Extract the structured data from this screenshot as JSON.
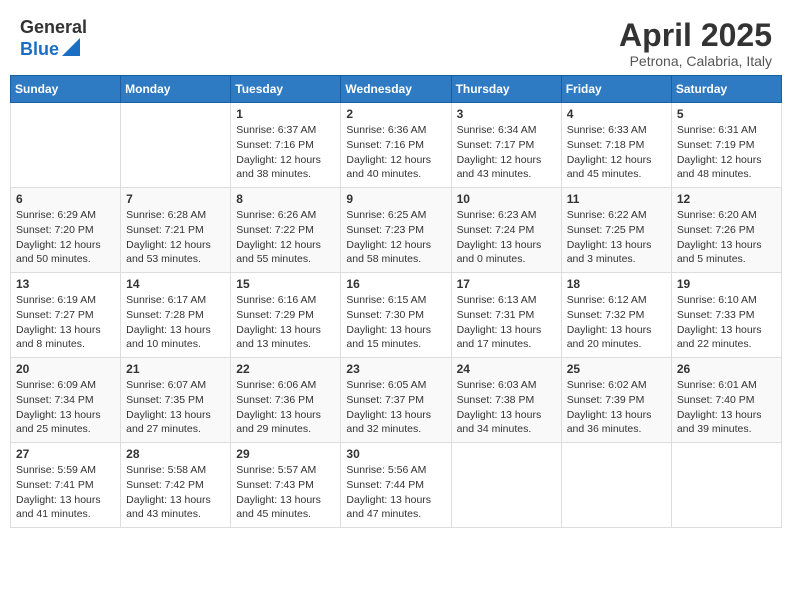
{
  "header": {
    "logo_general": "General",
    "logo_blue": "Blue",
    "month_year": "April 2025",
    "location": "Petrona, Calabria, Italy"
  },
  "days_of_week": [
    "Sunday",
    "Monday",
    "Tuesday",
    "Wednesday",
    "Thursday",
    "Friday",
    "Saturday"
  ],
  "weeks": [
    [
      {
        "day": "",
        "sunrise": "",
        "sunset": "",
        "daylight": ""
      },
      {
        "day": "",
        "sunrise": "",
        "sunset": "",
        "daylight": ""
      },
      {
        "day": "1",
        "sunrise": "Sunrise: 6:37 AM",
        "sunset": "Sunset: 7:16 PM",
        "daylight": "Daylight: 12 hours and 38 minutes."
      },
      {
        "day": "2",
        "sunrise": "Sunrise: 6:36 AM",
        "sunset": "Sunset: 7:16 PM",
        "daylight": "Daylight: 12 hours and 40 minutes."
      },
      {
        "day": "3",
        "sunrise": "Sunrise: 6:34 AM",
        "sunset": "Sunset: 7:17 PM",
        "daylight": "Daylight: 12 hours and 43 minutes."
      },
      {
        "day": "4",
        "sunrise": "Sunrise: 6:33 AM",
        "sunset": "Sunset: 7:18 PM",
        "daylight": "Daylight: 12 hours and 45 minutes."
      },
      {
        "day": "5",
        "sunrise": "Sunrise: 6:31 AM",
        "sunset": "Sunset: 7:19 PM",
        "daylight": "Daylight: 12 hours and 48 minutes."
      }
    ],
    [
      {
        "day": "6",
        "sunrise": "Sunrise: 6:29 AM",
        "sunset": "Sunset: 7:20 PM",
        "daylight": "Daylight: 12 hours and 50 minutes."
      },
      {
        "day": "7",
        "sunrise": "Sunrise: 6:28 AM",
        "sunset": "Sunset: 7:21 PM",
        "daylight": "Daylight: 12 hours and 53 minutes."
      },
      {
        "day": "8",
        "sunrise": "Sunrise: 6:26 AM",
        "sunset": "Sunset: 7:22 PM",
        "daylight": "Daylight: 12 hours and 55 minutes."
      },
      {
        "day": "9",
        "sunrise": "Sunrise: 6:25 AM",
        "sunset": "Sunset: 7:23 PM",
        "daylight": "Daylight: 12 hours and 58 minutes."
      },
      {
        "day": "10",
        "sunrise": "Sunrise: 6:23 AM",
        "sunset": "Sunset: 7:24 PM",
        "daylight": "Daylight: 13 hours and 0 minutes."
      },
      {
        "day": "11",
        "sunrise": "Sunrise: 6:22 AM",
        "sunset": "Sunset: 7:25 PM",
        "daylight": "Daylight: 13 hours and 3 minutes."
      },
      {
        "day": "12",
        "sunrise": "Sunrise: 6:20 AM",
        "sunset": "Sunset: 7:26 PM",
        "daylight": "Daylight: 13 hours and 5 minutes."
      }
    ],
    [
      {
        "day": "13",
        "sunrise": "Sunrise: 6:19 AM",
        "sunset": "Sunset: 7:27 PM",
        "daylight": "Daylight: 13 hours and 8 minutes."
      },
      {
        "day": "14",
        "sunrise": "Sunrise: 6:17 AM",
        "sunset": "Sunset: 7:28 PM",
        "daylight": "Daylight: 13 hours and 10 minutes."
      },
      {
        "day": "15",
        "sunrise": "Sunrise: 6:16 AM",
        "sunset": "Sunset: 7:29 PM",
        "daylight": "Daylight: 13 hours and 13 minutes."
      },
      {
        "day": "16",
        "sunrise": "Sunrise: 6:15 AM",
        "sunset": "Sunset: 7:30 PM",
        "daylight": "Daylight: 13 hours and 15 minutes."
      },
      {
        "day": "17",
        "sunrise": "Sunrise: 6:13 AM",
        "sunset": "Sunset: 7:31 PM",
        "daylight": "Daylight: 13 hours and 17 minutes."
      },
      {
        "day": "18",
        "sunrise": "Sunrise: 6:12 AM",
        "sunset": "Sunset: 7:32 PM",
        "daylight": "Daylight: 13 hours and 20 minutes."
      },
      {
        "day": "19",
        "sunrise": "Sunrise: 6:10 AM",
        "sunset": "Sunset: 7:33 PM",
        "daylight": "Daylight: 13 hours and 22 minutes."
      }
    ],
    [
      {
        "day": "20",
        "sunrise": "Sunrise: 6:09 AM",
        "sunset": "Sunset: 7:34 PM",
        "daylight": "Daylight: 13 hours and 25 minutes."
      },
      {
        "day": "21",
        "sunrise": "Sunrise: 6:07 AM",
        "sunset": "Sunset: 7:35 PM",
        "daylight": "Daylight: 13 hours and 27 minutes."
      },
      {
        "day": "22",
        "sunrise": "Sunrise: 6:06 AM",
        "sunset": "Sunset: 7:36 PM",
        "daylight": "Daylight: 13 hours and 29 minutes."
      },
      {
        "day": "23",
        "sunrise": "Sunrise: 6:05 AM",
        "sunset": "Sunset: 7:37 PM",
        "daylight": "Daylight: 13 hours and 32 minutes."
      },
      {
        "day": "24",
        "sunrise": "Sunrise: 6:03 AM",
        "sunset": "Sunset: 7:38 PM",
        "daylight": "Daylight: 13 hours and 34 minutes."
      },
      {
        "day": "25",
        "sunrise": "Sunrise: 6:02 AM",
        "sunset": "Sunset: 7:39 PM",
        "daylight": "Daylight: 13 hours and 36 minutes."
      },
      {
        "day": "26",
        "sunrise": "Sunrise: 6:01 AM",
        "sunset": "Sunset: 7:40 PM",
        "daylight": "Daylight: 13 hours and 39 minutes."
      }
    ],
    [
      {
        "day": "27",
        "sunrise": "Sunrise: 5:59 AM",
        "sunset": "Sunset: 7:41 PM",
        "daylight": "Daylight: 13 hours and 41 minutes."
      },
      {
        "day": "28",
        "sunrise": "Sunrise: 5:58 AM",
        "sunset": "Sunset: 7:42 PM",
        "daylight": "Daylight: 13 hours and 43 minutes."
      },
      {
        "day": "29",
        "sunrise": "Sunrise: 5:57 AM",
        "sunset": "Sunset: 7:43 PM",
        "daylight": "Daylight: 13 hours and 45 minutes."
      },
      {
        "day": "30",
        "sunrise": "Sunrise: 5:56 AM",
        "sunset": "Sunset: 7:44 PM",
        "daylight": "Daylight: 13 hours and 47 minutes."
      },
      {
        "day": "",
        "sunrise": "",
        "sunset": "",
        "daylight": ""
      },
      {
        "day": "",
        "sunrise": "",
        "sunset": "",
        "daylight": ""
      },
      {
        "day": "",
        "sunrise": "",
        "sunset": "",
        "daylight": ""
      }
    ]
  ]
}
